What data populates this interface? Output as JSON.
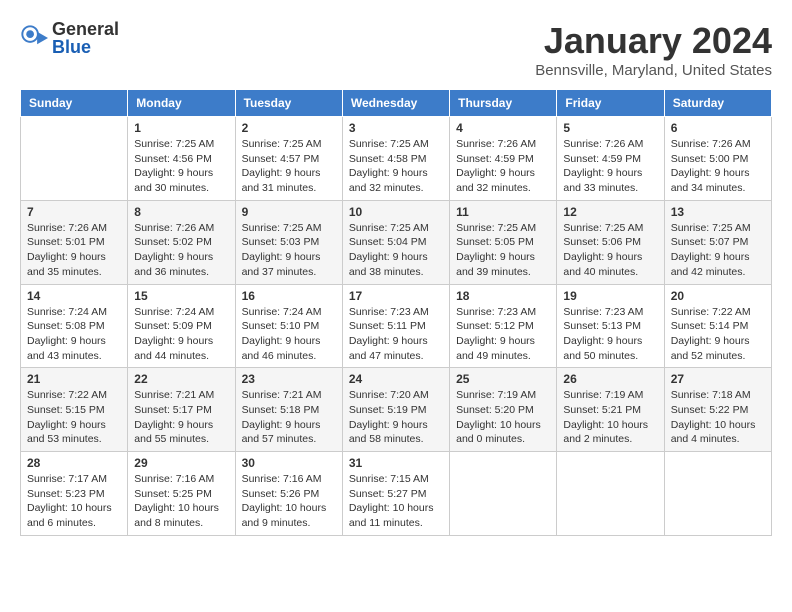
{
  "logo": {
    "general": "General",
    "blue": "Blue"
  },
  "title": "January 2024",
  "location": "Bennsville, Maryland, United States",
  "days_of_week": [
    "Sunday",
    "Monday",
    "Tuesday",
    "Wednesday",
    "Thursday",
    "Friday",
    "Saturday"
  ],
  "weeks": [
    [
      {
        "day": "",
        "info": ""
      },
      {
        "day": "1",
        "info": "Sunrise: 7:25 AM\nSunset: 4:56 PM\nDaylight: 9 hours\nand 30 minutes."
      },
      {
        "day": "2",
        "info": "Sunrise: 7:25 AM\nSunset: 4:57 PM\nDaylight: 9 hours\nand 31 minutes."
      },
      {
        "day": "3",
        "info": "Sunrise: 7:25 AM\nSunset: 4:58 PM\nDaylight: 9 hours\nand 32 minutes."
      },
      {
        "day": "4",
        "info": "Sunrise: 7:26 AM\nSunset: 4:59 PM\nDaylight: 9 hours\nand 32 minutes."
      },
      {
        "day": "5",
        "info": "Sunrise: 7:26 AM\nSunset: 4:59 PM\nDaylight: 9 hours\nand 33 minutes."
      },
      {
        "day": "6",
        "info": "Sunrise: 7:26 AM\nSunset: 5:00 PM\nDaylight: 9 hours\nand 34 minutes."
      }
    ],
    [
      {
        "day": "7",
        "info": "Sunrise: 7:26 AM\nSunset: 5:01 PM\nDaylight: 9 hours\nand 35 minutes."
      },
      {
        "day": "8",
        "info": "Sunrise: 7:26 AM\nSunset: 5:02 PM\nDaylight: 9 hours\nand 36 minutes."
      },
      {
        "day": "9",
        "info": "Sunrise: 7:25 AM\nSunset: 5:03 PM\nDaylight: 9 hours\nand 37 minutes."
      },
      {
        "day": "10",
        "info": "Sunrise: 7:25 AM\nSunset: 5:04 PM\nDaylight: 9 hours\nand 38 minutes."
      },
      {
        "day": "11",
        "info": "Sunrise: 7:25 AM\nSunset: 5:05 PM\nDaylight: 9 hours\nand 39 minutes."
      },
      {
        "day": "12",
        "info": "Sunrise: 7:25 AM\nSunset: 5:06 PM\nDaylight: 9 hours\nand 40 minutes."
      },
      {
        "day": "13",
        "info": "Sunrise: 7:25 AM\nSunset: 5:07 PM\nDaylight: 9 hours\nand 42 minutes."
      }
    ],
    [
      {
        "day": "14",
        "info": "Sunrise: 7:24 AM\nSunset: 5:08 PM\nDaylight: 9 hours\nand 43 minutes."
      },
      {
        "day": "15",
        "info": "Sunrise: 7:24 AM\nSunset: 5:09 PM\nDaylight: 9 hours\nand 44 minutes."
      },
      {
        "day": "16",
        "info": "Sunrise: 7:24 AM\nSunset: 5:10 PM\nDaylight: 9 hours\nand 46 minutes."
      },
      {
        "day": "17",
        "info": "Sunrise: 7:23 AM\nSunset: 5:11 PM\nDaylight: 9 hours\nand 47 minutes."
      },
      {
        "day": "18",
        "info": "Sunrise: 7:23 AM\nSunset: 5:12 PM\nDaylight: 9 hours\nand 49 minutes."
      },
      {
        "day": "19",
        "info": "Sunrise: 7:23 AM\nSunset: 5:13 PM\nDaylight: 9 hours\nand 50 minutes."
      },
      {
        "day": "20",
        "info": "Sunrise: 7:22 AM\nSunset: 5:14 PM\nDaylight: 9 hours\nand 52 minutes."
      }
    ],
    [
      {
        "day": "21",
        "info": "Sunrise: 7:22 AM\nSunset: 5:15 PM\nDaylight: 9 hours\nand 53 minutes."
      },
      {
        "day": "22",
        "info": "Sunrise: 7:21 AM\nSunset: 5:17 PM\nDaylight: 9 hours\nand 55 minutes."
      },
      {
        "day": "23",
        "info": "Sunrise: 7:21 AM\nSunset: 5:18 PM\nDaylight: 9 hours\nand 57 minutes."
      },
      {
        "day": "24",
        "info": "Sunrise: 7:20 AM\nSunset: 5:19 PM\nDaylight: 9 hours\nand 58 minutes."
      },
      {
        "day": "25",
        "info": "Sunrise: 7:19 AM\nSunset: 5:20 PM\nDaylight: 10 hours\nand 0 minutes."
      },
      {
        "day": "26",
        "info": "Sunrise: 7:19 AM\nSunset: 5:21 PM\nDaylight: 10 hours\nand 2 minutes."
      },
      {
        "day": "27",
        "info": "Sunrise: 7:18 AM\nSunset: 5:22 PM\nDaylight: 10 hours\nand 4 minutes."
      }
    ],
    [
      {
        "day": "28",
        "info": "Sunrise: 7:17 AM\nSunset: 5:23 PM\nDaylight: 10 hours\nand 6 minutes."
      },
      {
        "day": "29",
        "info": "Sunrise: 7:16 AM\nSunset: 5:25 PM\nDaylight: 10 hours\nand 8 minutes."
      },
      {
        "day": "30",
        "info": "Sunrise: 7:16 AM\nSunset: 5:26 PM\nDaylight: 10 hours\nand 9 minutes."
      },
      {
        "day": "31",
        "info": "Sunrise: 7:15 AM\nSunset: 5:27 PM\nDaylight: 10 hours\nand 11 minutes."
      },
      {
        "day": "",
        "info": ""
      },
      {
        "day": "",
        "info": ""
      },
      {
        "day": "",
        "info": ""
      }
    ]
  ]
}
